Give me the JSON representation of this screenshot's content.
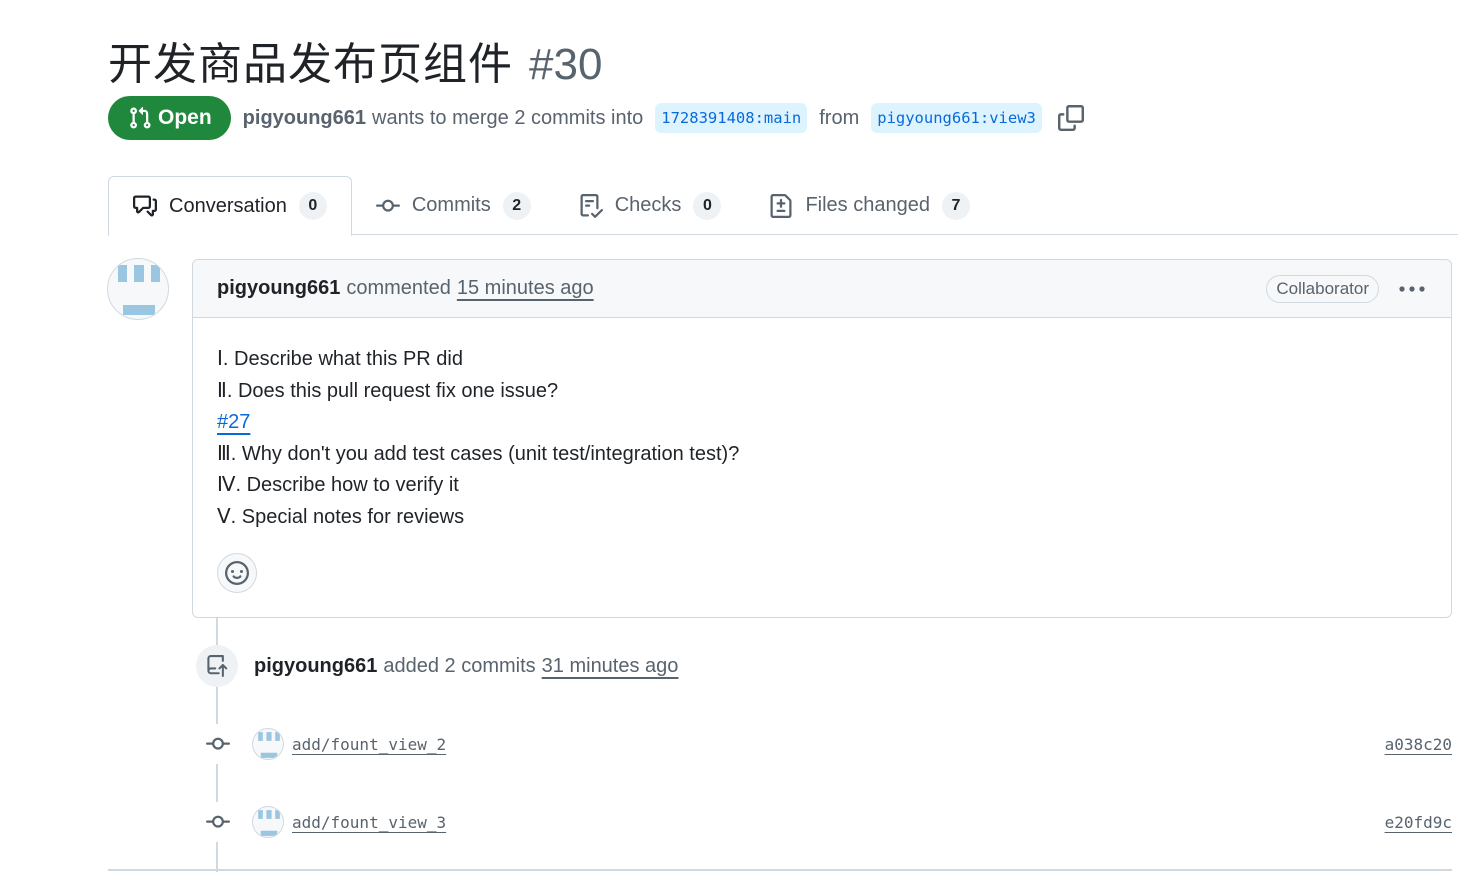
{
  "pr": {
    "title": "开发商品发布页组件",
    "number": "#30",
    "state": "Open",
    "author": "pigyoung661",
    "merge_text": "wants to merge 2 commits into",
    "base_branch": "1728391408:main",
    "from_text": "from",
    "head_branch": "pigyoung661:view3"
  },
  "tabs": [
    {
      "label": "Conversation",
      "count": "0"
    },
    {
      "label": "Commits",
      "count": "2"
    },
    {
      "label": "Checks",
      "count": "0"
    },
    {
      "label": "Files changed",
      "count": "7"
    }
  ],
  "comment": {
    "author": "pigyoung661",
    "action": "commented",
    "timestamp": "15 minutes ago",
    "role": "Collaborator",
    "lines": [
      "Ⅰ. Describe what this PR did",
      "Ⅱ. Does this pull request fix one issue?",
      "#27",
      "Ⅲ. Why don't you add test cases (unit test/integration test)?",
      "Ⅳ. Describe how to verify it",
      "Ⅴ. Special notes for reviews"
    ]
  },
  "timeline": {
    "event_author": "pigyoung661",
    "event_text": "added 2 commits",
    "event_time": "31 minutes ago",
    "commits": [
      {
        "message": "add/fount_view_2",
        "sha": "a038c20"
      },
      {
        "message": "add/fount_view_3",
        "sha": "e20fd9c"
      }
    ]
  },
  "colors": {
    "open_green": "#1f883d",
    "link_blue": "#0969da",
    "branch_bg": "#ddf4ff",
    "avatar_blue": "#9ac6e2"
  }
}
